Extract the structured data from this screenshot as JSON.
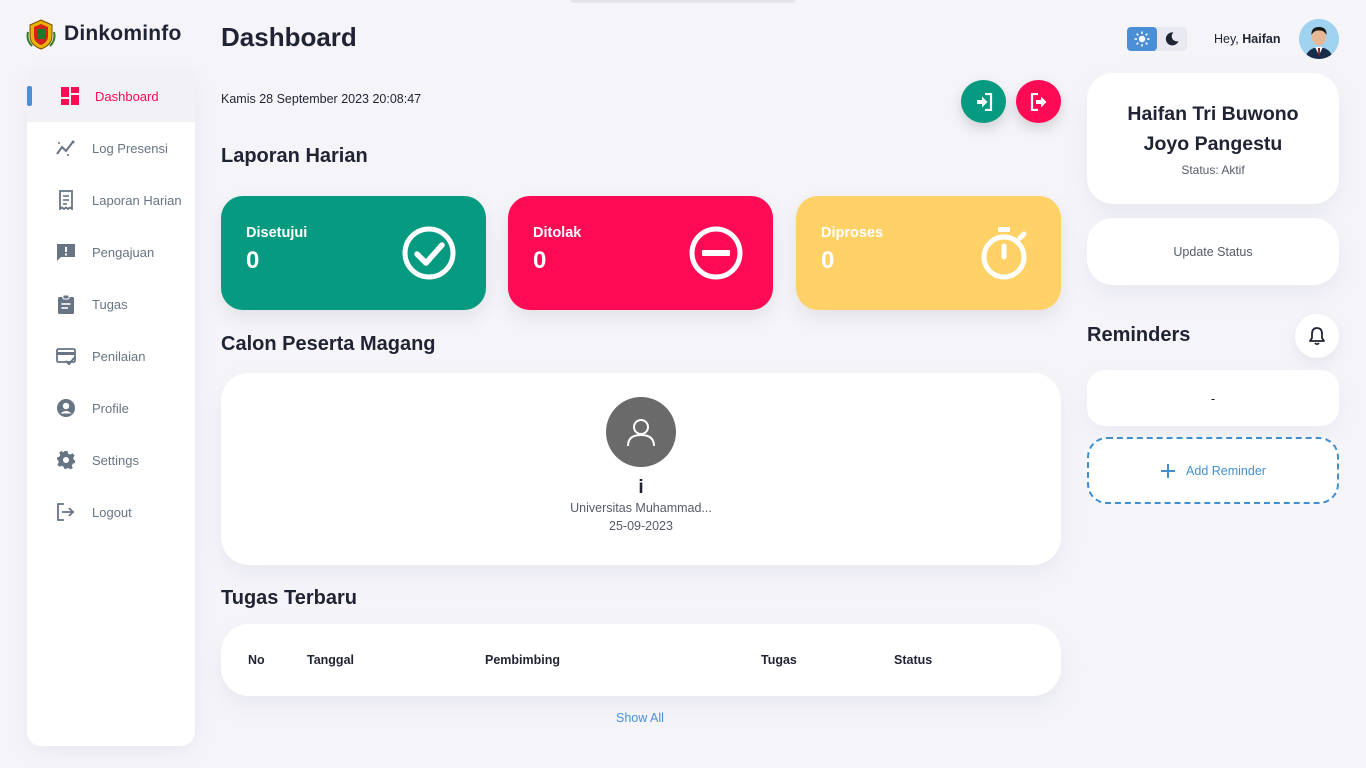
{
  "brand": {
    "name": "Dinkominfo"
  },
  "sidebar": {
    "items": [
      {
        "label": "Dashboard",
        "icon": "dashboard-icon",
        "active": true
      },
      {
        "label": "Log Presensi",
        "icon": "chart-line-icon"
      },
      {
        "label": "Laporan Harian",
        "icon": "receipt-icon"
      },
      {
        "label": "Pengajuan",
        "icon": "feedback-icon"
      },
      {
        "label": "Tugas",
        "icon": "clipboard-icon"
      },
      {
        "label": "Penilaian",
        "icon": "card-check-icon"
      },
      {
        "label": "Profile",
        "icon": "account-circle-icon"
      },
      {
        "label": "Settings",
        "icon": "gear-icon"
      },
      {
        "label": "Logout",
        "icon": "logout-icon"
      }
    ]
  },
  "header": {
    "title": "Dashboard",
    "datetime": "Kamis 28 September 2023 20:08:47",
    "greeting_prefix": "Hey,",
    "greeting_name": "Haifan"
  },
  "laporan": {
    "title": "Laporan Harian",
    "cards": [
      {
        "label": "Disetujui",
        "value": "0",
        "color": "#069a80",
        "icon": "check-circle-icon"
      },
      {
        "label": "Ditolak",
        "value": "0",
        "color": "#ff0a54",
        "icon": "minus-circle-icon"
      },
      {
        "label": "Diproses",
        "value": "0",
        "color": "#ffd166",
        "icon": "stopwatch-icon"
      }
    ]
  },
  "calon": {
    "title": "Calon Peserta Magang",
    "name": "i",
    "school": "Universitas Muhammad...",
    "date": "25-09-2023"
  },
  "tugas": {
    "title": "Tugas Terbaru",
    "columns": [
      "No",
      "Tanggal",
      "Pembimbing",
      "Tugas",
      "Status"
    ],
    "show_all": "Show All"
  },
  "profile": {
    "name_line1": "Haifan Tri Buwono",
    "name_line2": "Joyo Pangestu",
    "status": "Status: Aktif",
    "update_status": "Update Status"
  },
  "reminders": {
    "title": "Reminders",
    "items": [
      "-"
    ],
    "add_label": "Add Reminder"
  },
  "colors": {
    "accent": "#ff0a54",
    "green": "#069a80",
    "yellow": "#ffd166",
    "blue": "#4a8fd6"
  }
}
